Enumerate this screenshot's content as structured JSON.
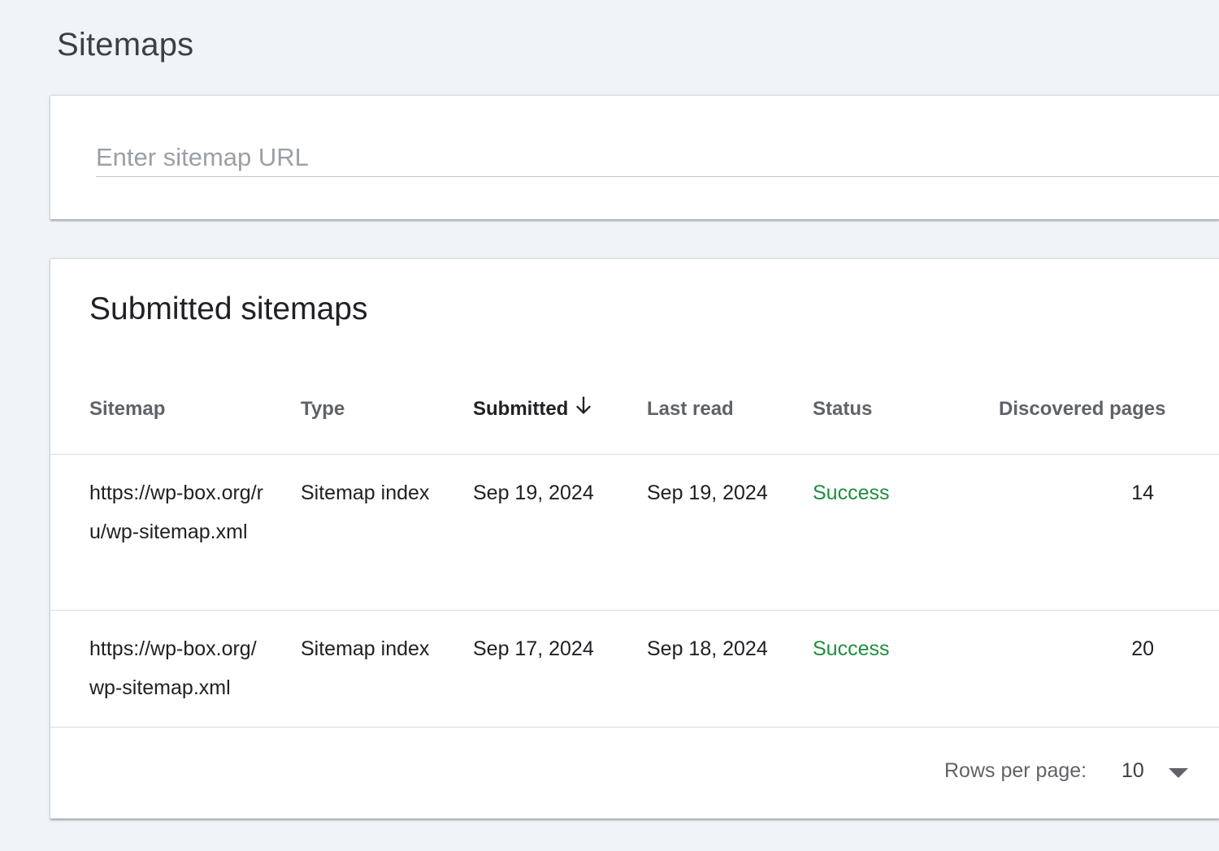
{
  "page": {
    "title": "Sitemaps"
  },
  "add_sitemap": {
    "placeholder": "Enter sitemap URL",
    "value": ""
  },
  "submitted": {
    "title": "Submitted sitemaps",
    "columns": {
      "sitemap": "Sitemap",
      "type": "Type",
      "submitted": "Submitted",
      "last_read": "Last read",
      "status": "Status",
      "discovered_pages": "Discovered pages"
    },
    "sort": {
      "column": "submitted",
      "direction": "descending",
      "icon": "arrow-down-icon"
    },
    "rows": [
      {
        "sitemap": "https://wp-box.org/ru/wp-sitemap.xml",
        "type": "Sitemap index",
        "submitted": "Sep 19, 2024",
        "last_read": "Sep 19, 2024",
        "status": "Success",
        "discovered_pages": "14"
      },
      {
        "sitemap": "https://wp-box.org/wp-sitemap.xml",
        "type": "Sitemap index",
        "submitted": "Sep 17, 2024",
        "last_read": "Sep 18, 2024",
        "status": "Success",
        "discovered_pages": "20"
      }
    ],
    "pagination": {
      "rows_per_page_label": "Rows per page:",
      "rows_per_page_value": "10"
    }
  },
  "colors": {
    "background": "#f0f4f9",
    "success": "#1e8e3e",
    "header_text": "#5f6368"
  }
}
